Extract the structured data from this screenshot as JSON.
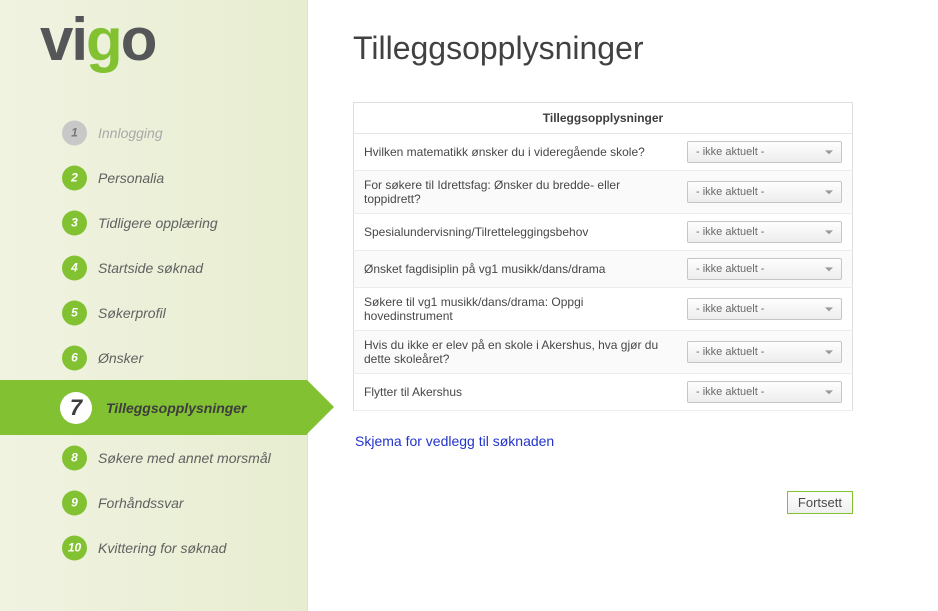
{
  "logo": {
    "p1": "vi",
    "p2": "g",
    "p3": "o"
  },
  "page": {
    "title": "Tilleggsopplysninger"
  },
  "sidebar": {
    "steps": [
      {
        "n": "1",
        "label": "Innlogging",
        "state": "disabled"
      },
      {
        "n": "2",
        "label": "Personalia",
        "state": ""
      },
      {
        "n": "3",
        "label": "Tidligere opplæring",
        "state": ""
      },
      {
        "n": "4",
        "label": "Startside søknad",
        "state": ""
      },
      {
        "n": "5",
        "label": "Søkerprofil",
        "state": ""
      },
      {
        "n": "6",
        "label": "Ønsker",
        "state": ""
      },
      {
        "n": "7",
        "label": "Tilleggsopplysninger",
        "state": "active"
      },
      {
        "n": "8",
        "label": "Søkere med annet morsmål",
        "state": ""
      },
      {
        "n": "9",
        "label": "Forhåndssvar",
        "state": ""
      },
      {
        "n": "10",
        "label": "Kvittering for søknad",
        "state": ""
      }
    ]
  },
  "panel": {
    "header": "Tilleggsopplysninger",
    "default_select": "- ikke aktuelt -",
    "rows": [
      {
        "label": "Hvilken matematikk ønsker du i videregående skole?"
      },
      {
        "label": "For søkere til Idrettsfag: Ønsker du bredde- eller toppidrett?"
      },
      {
        "label": "Spesialundervisning/Tilretteleggingsbehov"
      },
      {
        "label": "Ønsket fagdisiplin på vg1 musikk/dans/drama"
      },
      {
        "label": "Søkere til vg1 musikk/dans/drama: Oppgi hovedinstrument"
      },
      {
        "label": "Hvis du ikke er elev på en skole i Akershus, hva gjør du dette skoleåret?"
      },
      {
        "label": "Flytter til Akershus"
      }
    ]
  },
  "link": {
    "text": "Skjema for vedlegg til søknaden"
  },
  "actions": {
    "continue": "Fortsett"
  }
}
